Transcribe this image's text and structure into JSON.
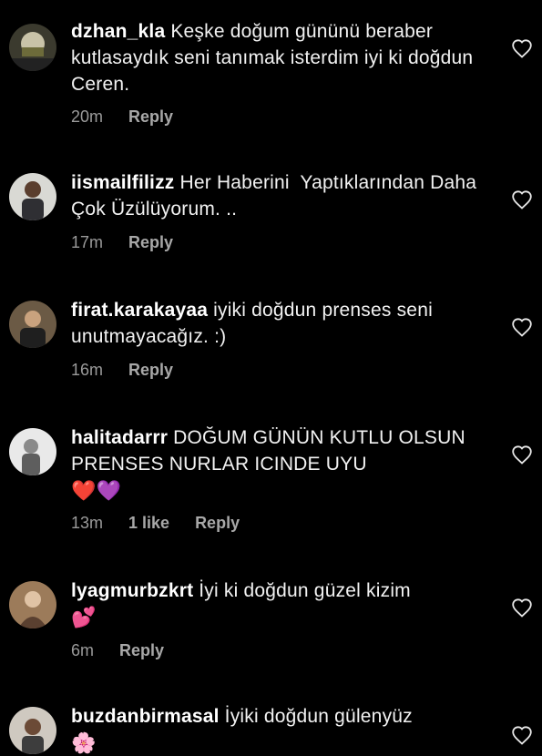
{
  "comments": [
    {
      "username": "dzhan_kla",
      "text": "Keşke doğum gününü beraber kutlasaydık seni tanımak isterdim iyi ki doğdun Ceren.",
      "emojis": "",
      "time": "20m",
      "likes": "",
      "reply": "Reply"
    },
    {
      "username": "iismailfilizz",
      "text": "Her Haberini  Yaptıklarından Daha Çok Üzülüyorum. ..",
      "emojis": "",
      "time": "17m",
      "likes": "",
      "reply": "Reply"
    },
    {
      "username": "firat.karakayaa",
      "text": "iyiki doğdun prenses seni unutmayacağız. :)",
      "emojis": "",
      "time": "16m",
      "likes": "",
      "reply": "Reply"
    },
    {
      "username": "halitadarrr",
      "text": "DOĞUM GÜNÜN KUTLU OLSUN PRENSES NURLAR ICINDE UYU",
      "emojis": "❤️💜",
      "time": "13m",
      "likes": "1 like",
      "reply": "Reply"
    },
    {
      "username": "lyagmurbzkrt",
      "text": "İyi ki doğdun güzel kizim",
      "emojis": "💕",
      "time": "6m",
      "likes": "",
      "reply": "Reply"
    },
    {
      "username": "buzdanbirmasal",
      "text": "İyiki doğdun gülenyüz",
      "emojis": "🌸",
      "time": "",
      "likes": "",
      "reply": ""
    }
  ],
  "icons": {
    "like": "heart-outline-icon"
  },
  "colors": {
    "background": "#000000",
    "text": "#f5f5f5",
    "meta": "#9a9a9a"
  }
}
